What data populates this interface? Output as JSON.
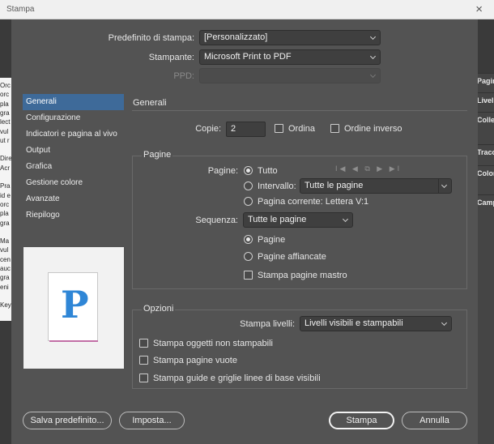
{
  "window": {
    "title": "Stampa",
    "close_glyph": "×"
  },
  "background_app": {
    "left_text_lines": [
      "Orc",
      "orc",
      "pla",
      "gra",
      "lect",
      "vul",
      "ut r",
      "",
      "Dire",
      "Acr",
      "",
      "Pra",
      "id e",
      "orc",
      "pla",
      "gra",
      "",
      "Ma",
      "vul",
      "cen",
      "auc",
      "gra",
      "eni",
      "",
      "Key"
    ],
    "right_items": [
      "Pagin",
      "Livelli",
      "Colle",
      "Tracc",
      "Color",
      "Camp"
    ]
  },
  "header": {
    "preset_label": "Predefinito di stampa:",
    "preset_value": "[Personalizzato]",
    "printer_label": "Stampante:",
    "printer_value": "Microsoft Print to PDF",
    "ppd_label": "PPD:",
    "ppd_value": ""
  },
  "nav": {
    "items": [
      {
        "label": "Generali",
        "selected": true
      },
      {
        "label": "Configurazione"
      },
      {
        "label": "Indicatori e pagina al vivo"
      },
      {
        "label": "Output"
      },
      {
        "label": "Grafica"
      },
      {
        "label": "Gestione colore"
      },
      {
        "label": "Avanzate"
      },
      {
        "label": "Riepilogo"
      }
    ]
  },
  "preview": {
    "letter": "P"
  },
  "general": {
    "title": "Generali",
    "copies_label": "Copie:",
    "copies_value": "2",
    "collate_label": "Ordina",
    "reverse_label": "Ordine inverso"
  },
  "pages": {
    "title": "Pagine",
    "pages_label": "Pagine:",
    "all_label": "Tutto",
    "range_label": "Intervallo:",
    "range_value": "Tutte le pagine",
    "current_label": "Pagina corrente: Lettera V:1",
    "nav_icons": "I◀ ◀ ⧉ ▶ ▶I",
    "sequence_label": "Sequenza:",
    "sequence_value": "Tutte le pagine",
    "pages_option": "Pagine",
    "spreads_option": "Pagine affiancate",
    "master_label": "Stampa pagine mastro"
  },
  "options": {
    "title": "Opzioni",
    "layers_label": "Stampa livelli:",
    "layers_value": "Livelli visibili e stampabili",
    "nonprint_label": "Stampa oggetti non stampabili",
    "blank_label": "Stampa pagine vuote",
    "guides_label": "Stampa guide e griglie linee di base visibili"
  },
  "buttons": {
    "save_preset": "Salva predefinito...",
    "setup": "Imposta...",
    "print": "Stampa",
    "cancel": "Annulla"
  }
}
